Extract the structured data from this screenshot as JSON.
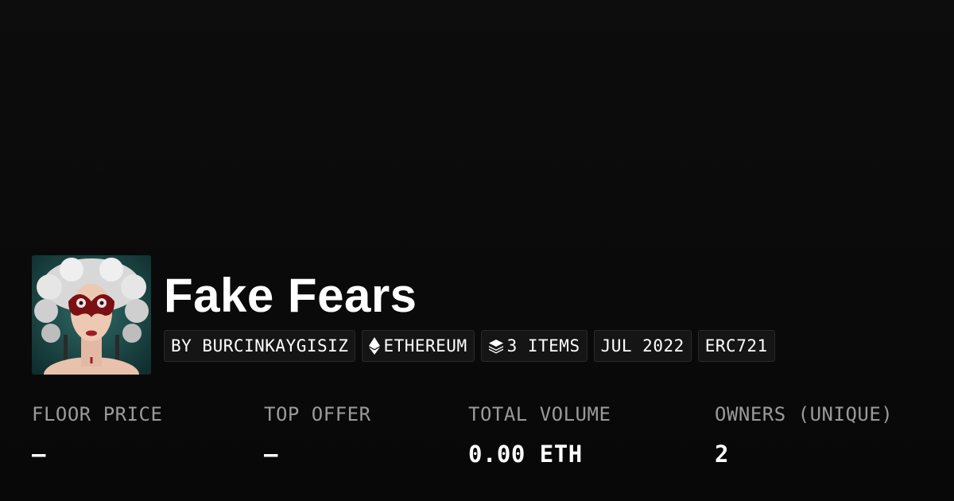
{
  "collection": {
    "title": "Fake Fears",
    "avatar_icon": "collection-avatar-image"
  },
  "tags": {
    "creator": "BY BURCINKAYGISIZ",
    "chain": "ETHEREUM",
    "chain_icon": "ethereum-icon",
    "items": "3 ITEMS",
    "items_icon": "layers-icon",
    "date": "JUL 2022",
    "standard": "ERC721"
  },
  "stats": {
    "floor_price": {
      "label": "FLOOR PRICE",
      "value": "–"
    },
    "top_offer": {
      "label": "TOP OFFER",
      "value": "–"
    },
    "total_volume": {
      "label": "TOTAL VOLUME",
      "value": "0.00 ETH"
    },
    "owners": {
      "label": "OWNERS (UNIQUE)",
      "value": "2"
    }
  },
  "colors": {
    "background": "#0b0b0b",
    "text": "#ffffff",
    "muted_text": "#9a9a9a",
    "tag_background": "#151515",
    "tag_border": "#2a2a2a"
  }
}
